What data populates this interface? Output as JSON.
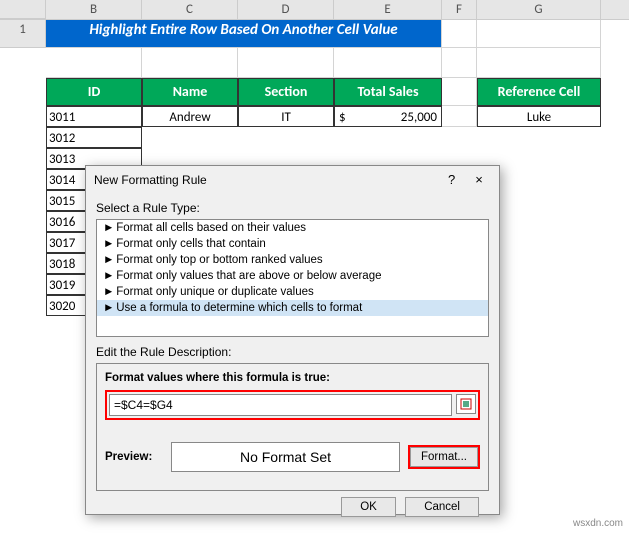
{
  "columns": [
    "B",
    "C",
    "D",
    "E",
    "F",
    "G"
  ],
  "title": "Highlight Entire Row Based On Another Cell Value",
  "headers": {
    "id": "ID",
    "name": "Name",
    "section": "Section",
    "total": "Total Sales",
    "ref": "Reference Cell"
  },
  "data_rows": [
    {
      "id": "3011",
      "name": "Andrew",
      "section": "IT",
      "currency": "$",
      "total": "25,000"
    },
    {
      "id": "3012"
    },
    {
      "id": "3013"
    },
    {
      "id": "3014"
    },
    {
      "id": "3015"
    },
    {
      "id": "3016"
    },
    {
      "id": "3017"
    },
    {
      "id": "3018"
    },
    {
      "id": "3019"
    },
    {
      "id": "3020"
    }
  ],
  "reference_value": "Luke",
  "dialog": {
    "title": "New Formatting Rule",
    "select_label": "Select a Rule Type:",
    "rules": [
      "Format all cells based on their values",
      "Format only cells that contain",
      "Format only top or bottom ranked values",
      "Format only values that are above or below average",
      "Format only unique or duplicate values",
      "Use a formula to determine which cells to format"
    ],
    "edit_label": "Edit the Rule Description:",
    "formula_label": "Format values where this formula is true:",
    "formula": "=$C4=$G4",
    "preview_label": "Preview:",
    "preview_text": "No Format Set",
    "format_btn": "Format...",
    "ok": "OK",
    "cancel": "Cancel",
    "help": "?",
    "close": "×"
  },
  "watermark": "wsxdn.com"
}
